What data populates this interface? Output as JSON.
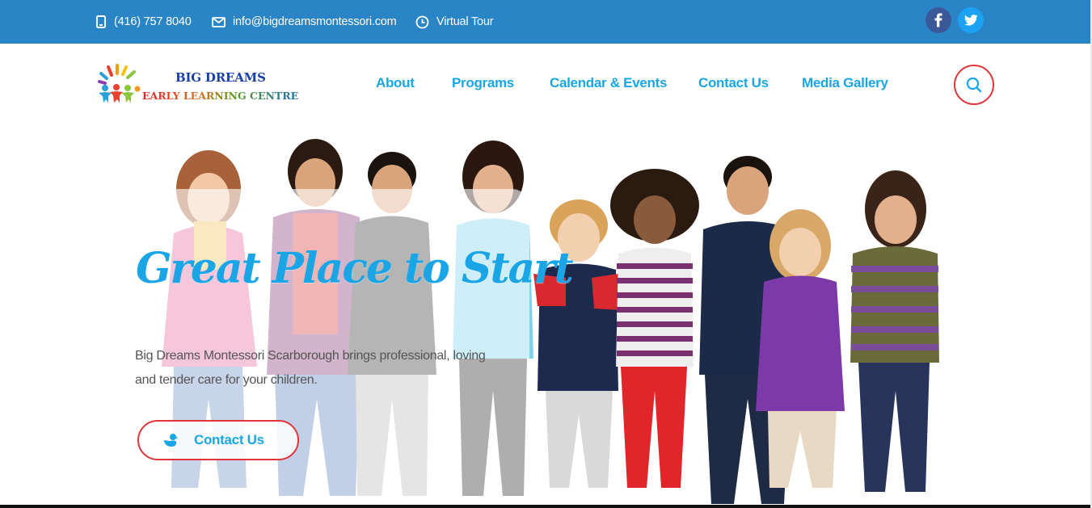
{
  "topbar": {
    "phone": "(416) 757 8040",
    "email": "info@bigdreamsmontessori.com",
    "tour": "Virtual Tour",
    "social": [
      {
        "icon": "facebook-icon",
        "color": "#3b5998"
      },
      {
        "icon": "twitter-icon",
        "color": "#1da1f2"
      }
    ]
  },
  "logo": {
    "line1": "BIG DREAMS",
    "line2": "EARLY LEARNING CENTRE"
  },
  "nav": {
    "items": [
      "About",
      "Programs",
      "Calendar & Events",
      "Contact Us",
      "Media Gallery"
    ],
    "search_icon": "search-icon"
  },
  "hero": {
    "title": "Great Place to Start",
    "text": "Big Dreams Montessori Scarborough brings professional, loving and tender care for your children.",
    "button_label": "Contact Us",
    "button_icon": "duck-icon"
  },
  "colors": {
    "topbar": "#2a85c7",
    "accent_blue": "#1aa6e6",
    "accent_red": "#e0353a",
    "logo_blue": "#1a3fa6"
  }
}
